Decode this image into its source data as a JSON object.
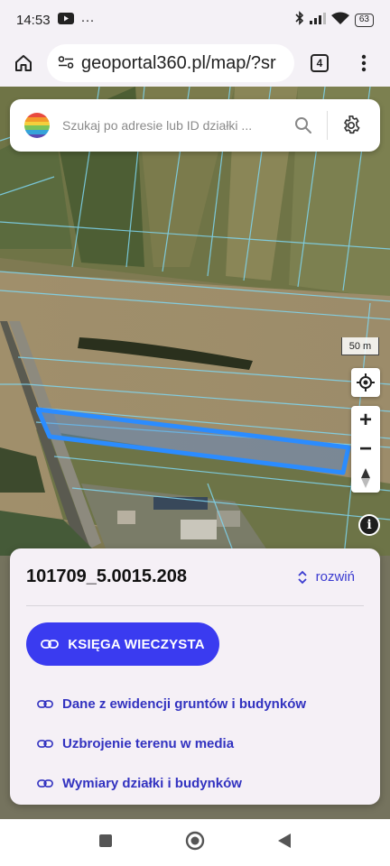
{
  "status": {
    "time": "14:53",
    "battery": "63"
  },
  "browser": {
    "url": "geoportal360.pl/map/?sr",
    "tab_count": "4"
  },
  "search": {
    "placeholder": "Szukaj po adresie lub ID działki ..."
  },
  "map": {
    "scale_label": "50 m",
    "zoom_in": "+",
    "zoom_out": "−",
    "info": "i",
    "highlight_color": "#2b8cff"
  },
  "card": {
    "parcel_id": "101709_5.0015.208",
    "expand_label": "rozwiń",
    "kw_button": "KSIĘGA WIECZYSTA",
    "links": [
      "Dane z ewidencji gruntów i budynków",
      "Uzbrojenie terenu w media",
      "Wymiary działki i budynków"
    ]
  },
  "colors": {
    "accent": "#3a3bf0",
    "link": "#3232c0"
  }
}
